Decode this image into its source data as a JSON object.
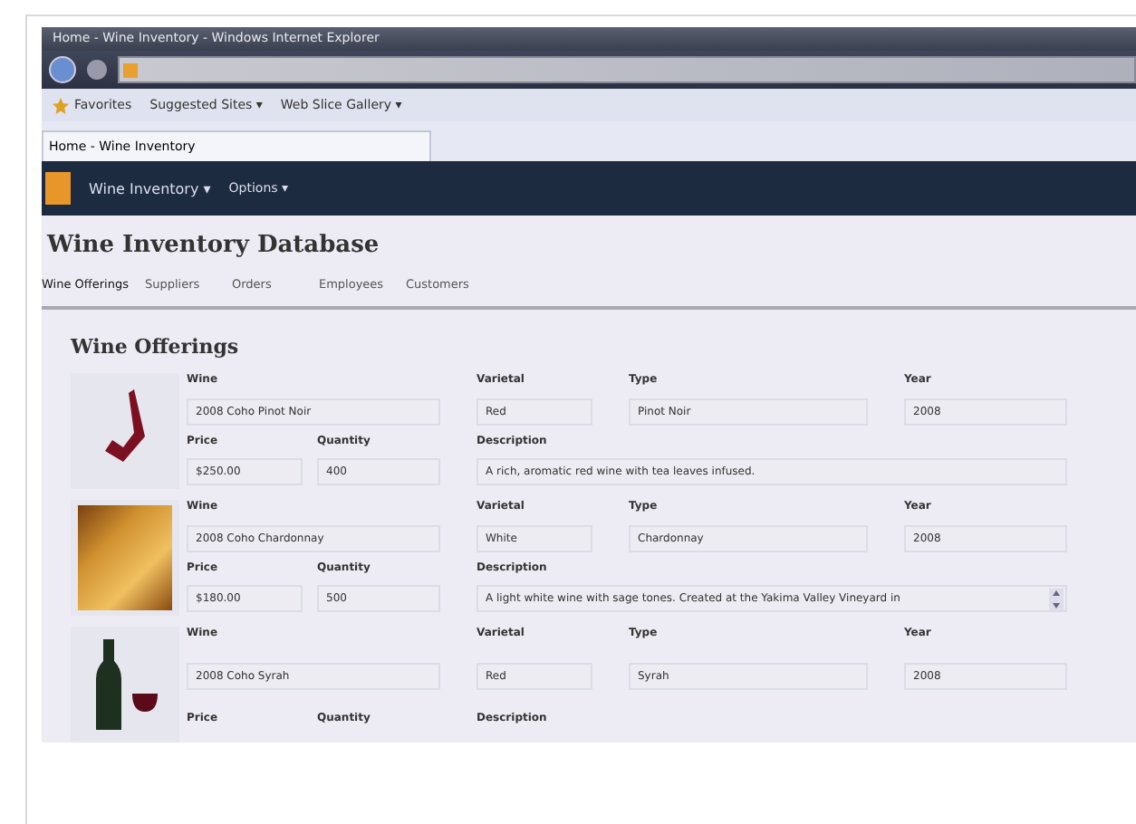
{
  "window": {
    "title": "Home - Wine Inventory - Windows Internet Explorer"
  },
  "favorites_bar": {
    "favorites": "Favorites",
    "links": [
      "Suggested Sites ▾",
      "Web Slice Gallery ▾"
    ]
  },
  "browser_tab": {
    "title": "Home - Wine Inventory"
  },
  "nav": {
    "items": [
      "Wine Inventory ▾",
      "Options ▾"
    ]
  },
  "page_title": "Wine Inventory Database",
  "tabs": [
    {
      "label": "Wine Offerings",
      "selected": true
    },
    {
      "label": "Suppliers",
      "selected": false
    },
    {
      "label": "Orders",
      "selected": false
    },
    {
      "label": "Employees",
      "selected": false
    },
    {
      "label": "Customers",
      "selected": false
    }
  ],
  "section_title": "Wine Offerings",
  "wines": [
    {
      "kind": "glass",
      "labels": {
        "wine": "Wine",
        "varietal": "Varietal",
        "type": "Type",
        "year": "Year",
        "price": "Price",
        "quantity": "Quantity",
        "description": "Description"
      },
      "wine": "2008 Coho Pinot Noir",
      "varietal": "Red",
      "type": "Pinot Noir",
      "year": "2008",
      "price": "$250.00",
      "quantity": "400",
      "description": "A rich, aromatic red wine with tea leaves infused.",
      "scrollable": false
    },
    {
      "kind": "photo",
      "labels": {
        "wine": "Wine",
        "varietal": "Varietal",
        "type": "Type",
        "year": "Year",
        "price": "Price",
        "quantity": "Quantity",
        "description": "Description"
      },
      "wine": "2008 Coho Chardonnay",
      "varietal": "White",
      "type": "Chardonnay",
      "year": "2008",
      "price": "$180.00",
      "quantity": "500",
      "description": "A light white wine with sage tones. Created at the Yakima Valley Vineyard in",
      "scrollable": true
    },
    {
      "kind": "bottle",
      "labels": {
        "wine": "Wine",
        "varietal": "Varietal",
        "type": "Type",
        "year": "Year",
        "price": "Price",
        "quantity": "Quantity",
        "description": "Description"
      },
      "wine": "2008 Coho Syrah",
      "varietal": "Red",
      "type": "Syrah",
      "year": "2008"
    }
  ]
}
